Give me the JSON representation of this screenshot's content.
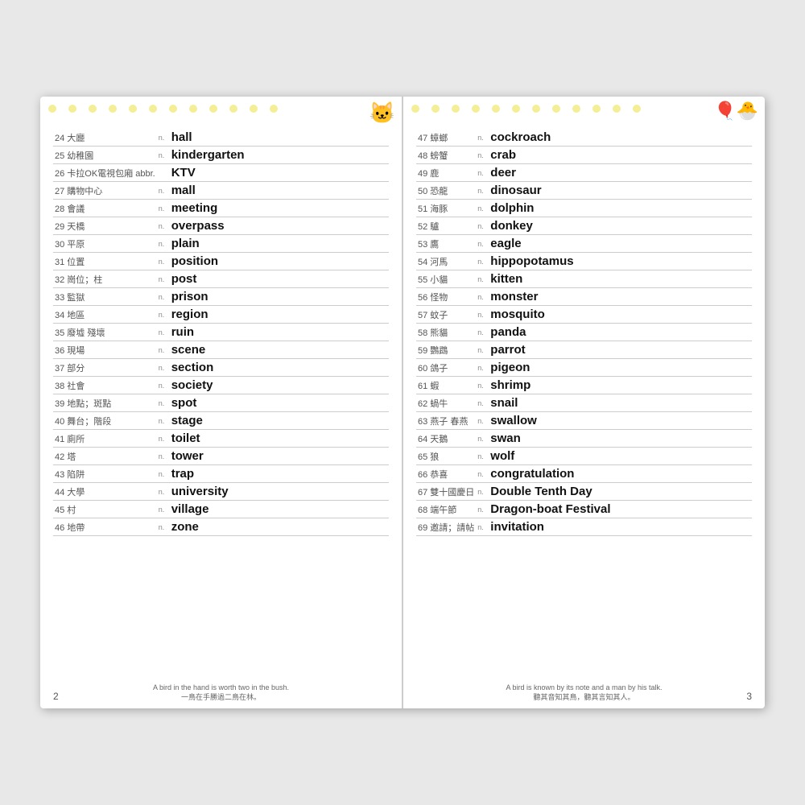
{
  "left_page": {
    "page_number": "2",
    "footer_quote_en": "A bird in the hand is worth two in the bush.",
    "footer_quote_zh": "一鳥在手勝過二鳥在林。",
    "words": [
      {
        "num": "24",
        "chinese": "大廳",
        "type": "n.",
        "english": "hall"
      },
      {
        "num": "25",
        "chinese": "幼稚園",
        "type": "n.",
        "english": "kindergarten"
      },
      {
        "num": "26",
        "chinese": "卡拉OK電視包廂 abbr.",
        "type": "",
        "english": "KTV"
      },
      {
        "num": "27",
        "chinese": "購物中心",
        "type": "n.",
        "english": "mall"
      },
      {
        "num": "28",
        "chinese": "會議",
        "type": "n.",
        "english": "meeting"
      },
      {
        "num": "29",
        "chinese": "天橋",
        "type": "n.",
        "english": "overpass"
      },
      {
        "num": "30",
        "chinese": "平原",
        "type": "n.",
        "english": "plain"
      },
      {
        "num": "31",
        "chinese": "位置",
        "type": "n.",
        "english": "position"
      },
      {
        "num": "32",
        "chinese": "崗位；柱",
        "type": "n.",
        "english": "post"
      },
      {
        "num": "33",
        "chinese": "監獄",
        "type": "n.",
        "english": "prison"
      },
      {
        "num": "34",
        "chinese": "地區",
        "type": "n.",
        "english": "region"
      },
      {
        "num": "35",
        "chinese": "廢墟 殘壞",
        "type": "n.",
        "english": "ruin"
      },
      {
        "num": "36",
        "chinese": "現場",
        "type": "n.",
        "english": "scene"
      },
      {
        "num": "37",
        "chinese": "部分",
        "type": "n.",
        "english": "section"
      },
      {
        "num": "38",
        "chinese": "社會",
        "type": "n.",
        "english": "society"
      },
      {
        "num": "39",
        "chinese": "地點；斑點",
        "type": "n.",
        "english": "spot"
      },
      {
        "num": "40",
        "chinese": "舞台；階段",
        "type": "n.",
        "english": "stage"
      },
      {
        "num": "41",
        "chinese": "廁所",
        "type": "n.",
        "english": "toilet"
      },
      {
        "num": "42",
        "chinese": "塔",
        "type": "n.",
        "english": "tower"
      },
      {
        "num": "43",
        "chinese": "陷阱",
        "type": "n.",
        "english": "trap"
      },
      {
        "num": "44",
        "chinese": "大學",
        "type": "n.",
        "english": "university"
      },
      {
        "num": "45",
        "chinese": "村",
        "type": "n.",
        "english": "village"
      },
      {
        "num": "46",
        "chinese": "地帶",
        "type": "n.",
        "english": "zone"
      }
    ]
  },
  "right_page": {
    "page_number": "3",
    "footer_quote_en": "A bird is known by its note and a man by his talk.",
    "footer_quote_zh": "聽其音知其鳥，聽其言知其人。",
    "words": [
      {
        "num": "47",
        "chinese": "蟑螂",
        "type": "n.",
        "english": "cockroach"
      },
      {
        "num": "48",
        "chinese": "螃蟹",
        "type": "n.",
        "english": "crab"
      },
      {
        "num": "49",
        "chinese": "鹿",
        "type": "n.",
        "english": "deer"
      },
      {
        "num": "50",
        "chinese": "恐龍",
        "type": "n.",
        "english": "dinosaur"
      },
      {
        "num": "51",
        "chinese": "海豚",
        "type": "n.",
        "english": "dolphin"
      },
      {
        "num": "52",
        "chinese": "驢",
        "type": "n.",
        "english": "donkey"
      },
      {
        "num": "53",
        "chinese": "鷹",
        "type": "n.",
        "english": "eagle"
      },
      {
        "num": "54",
        "chinese": "河馬",
        "type": "n.",
        "english": "hippopotamus"
      },
      {
        "num": "55",
        "chinese": "小貓",
        "type": "n.",
        "english": "kitten"
      },
      {
        "num": "56",
        "chinese": "怪物",
        "type": "n.",
        "english": "monster"
      },
      {
        "num": "57",
        "chinese": "蚊子",
        "type": "n.",
        "english": "mosquito"
      },
      {
        "num": "58",
        "chinese": "熊貓",
        "type": "n.",
        "english": "panda"
      },
      {
        "num": "59",
        "chinese": "鸚鵡",
        "type": "n.",
        "english": "parrot"
      },
      {
        "num": "60",
        "chinese": "鴿子",
        "type": "n.",
        "english": "pigeon"
      },
      {
        "num": "61",
        "chinese": "蝦",
        "type": "n.",
        "english": "shrimp"
      },
      {
        "num": "62",
        "chinese": "蝸牛",
        "type": "n.",
        "english": "snail"
      },
      {
        "num": "63",
        "chinese": "燕子 春燕",
        "type": "n.",
        "english": "swallow"
      },
      {
        "num": "64",
        "chinese": "天鵝",
        "type": "n.",
        "english": "swan"
      },
      {
        "num": "65",
        "chinese": "狼",
        "type": "n.",
        "english": "wolf"
      },
      {
        "num": "66",
        "chinese": "恭喜",
        "type": "n.",
        "english": "congratulation"
      },
      {
        "num": "67",
        "chinese": "雙十國慶日",
        "type": "n.",
        "english": "Double Tenth Day"
      },
      {
        "num": "68",
        "chinese": "端午節",
        "type": "n.",
        "english": "Dragon-boat Festival"
      },
      {
        "num": "69",
        "chinese": "邀請；請帖",
        "type": "n.",
        "english": "invitation"
      }
    ]
  },
  "dots": {
    "color": "#f0e86a"
  }
}
